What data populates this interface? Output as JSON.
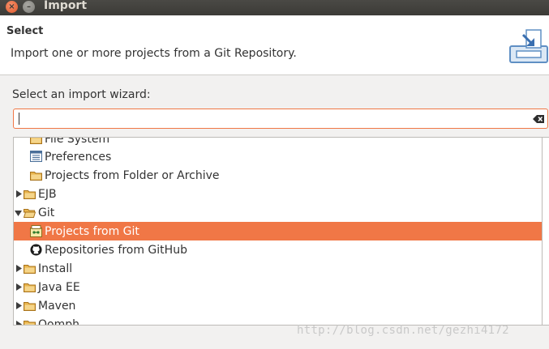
{
  "window": {
    "title": "Import",
    "close_glyph": "×",
    "minimize_glyph": "–"
  },
  "header": {
    "title": "Select",
    "description": "Import one or more projects from a Git Repository.",
    "icon": "import-wizard-icon"
  },
  "wizard": {
    "prompt": "Select an import wizard:",
    "filter_value": "",
    "clear_icon": "clear-filter-icon"
  },
  "tree": {
    "items": [
      {
        "label": "File System",
        "level": 1,
        "icon": "folder-icon"
      },
      {
        "label": "Preferences",
        "level": 1,
        "icon": "preferences-icon"
      },
      {
        "label": "Projects from Folder or Archive",
        "level": 1,
        "icon": "folder-icon"
      },
      {
        "label": "EJB",
        "level": 0,
        "icon": "folder-icon",
        "expanded": false
      },
      {
        "label": "Git",
        "level": 0,
        "icon": "folder-icon",
        "expanded": true
      },
      {
        "label": "Projects from Git",
        "level": 1,
        "icon": "git-projects-icon",
        "selected": true
      },
      {
        "label": "Repositories from GitHub",
        "level": 1,
        "icon": "github-icon"
      },
      {
        "label": "Install",
        "level": 0,
        "icon": "folder-icon",
        "expanded": false
      },
      {
        "label": "Java EE",
        "level": 0,
        "icon": "folder-icon",
        "expanded": false
      },
      {
        "label": "Maven",
        "level": 0,
        "icon": "folder-icon",
        "expanded": false
      },
      {
        "label": "Oomph",
        "level": 0,
        "icon": "folder-icon",
        "expanded": false
      }
    ]
  },
  "watermark": "http://blog.csdn.net/gezhi4172",
  "colors": {
    "accent": "#f07746",
    "titlebar": "#3c3b37",
    "folder": "#e8b44d"
  }
}
